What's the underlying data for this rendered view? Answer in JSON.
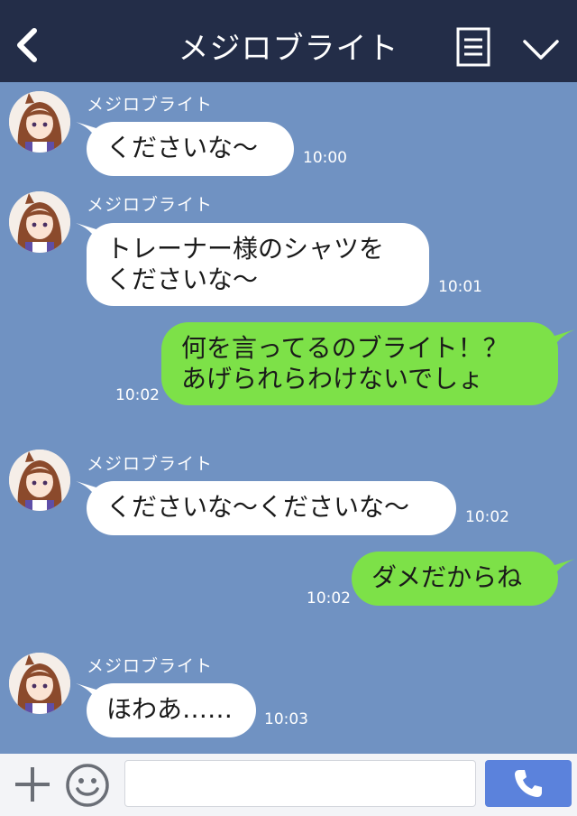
{
  "header": {
    "title": "メジロブライト",
    "back_icon": "chevron-left-icon",
    "menu_icon": "notes-icon",
    "collapse_icon": "chevron-down-icon"
  },
  "messages": [
    {
      "direction": "in",
      "sender": "メジロブライト",
      "lines": [
        "くださいな〜"
      ],
      "time": "10:00"
    },
    {
      "direction": "in",
      "sender": "メジロブライト",
      "lines": [
        "トレーナー様のシャツを",
        "くださいな〜"
      ],
      "time": "10:01"
    },
    {
      "direction": "out",
      "lines": [
        "何を言ってるのブライト！？",
        "あげられらわけないでしょ"
      ],
      "time": "10:02"
    },
    {
      "direction": "in",
      "sender": "メジロブライト",
      "lines": [
        "くださいな〜くださいな〜"
      ],
      "time": "10:02"
    },
    {
      "direction": "out",
      "lines": [
        "ダメだからね"
      ],
      "time": "10:02"
    },
    {
      "direction": "in",
      "sender": "メジロブライト",
      "lines": [
        "ほわあ……"
      ],
      "time": "10:03"
    }
  ],
  "footer": {
    "plus_icon": "plus-icon",
    "emoji_icon": "smile-icon",
    "message_value": "",
    "call_icon": "phone-icon"
  },
  "colors": {
    "header_bg": "#232d48",
    "chat_bg": "#7092c2",
    "incoming_bubble": "#ffffff",
    "outgoing_bubble": "#7de148",
    "call_button": "#5b82dc"
  }
}
